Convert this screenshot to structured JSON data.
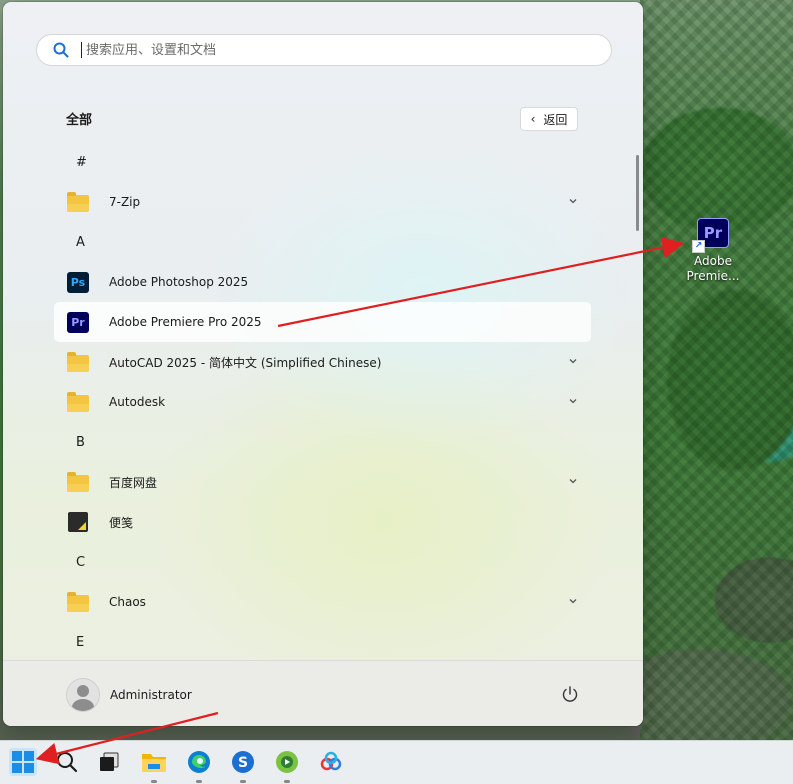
{
  "desktop": {
    "shortcut_icon_label": "Pr",
    "shortcut_caption_line1": "Adobe",
    "shortcut_caption_line2": "Premie..."
  },
  "start_menu": {
    "search_placeholder": "搜索应用、设置和文档",
    "section_title": "全部",
    "back_button": "返回",
    "list": [
      {
        "type": "letter",
        "text": "#"
      },
      {
        "type": "app",
        "icon": "folder-icon",
        "label": "7-Zip",
        "expandable": true
      },
      {
        "type": "letter",
        "text": "A"
      },
      {
        "type": "app",
        "icon": "photoshop-icon",
        "icon_text": "Ps",
        "label": "Adobe Photoshop 2025",
        "expandable": false
      },
      {
        "type": "app",
        "icon": "premiere-icon",
        "icon_text": "Pr",
        "label": "Adobe Premiere Pro 2025",
        "expandable": false,
        "selected": true
      },
      {
        "type": "app",
        "icon": "folder-icon",
        "label": "AutoCAD 2025 - 简体中文 (Simplified Chinese)",
        "expandable": true
      },
      {
        "type": "app",
        "icon": "folder-icon",
        "label": "Autodesk",
        "expandable": true
      },
      {
        "type": "letter",
        "text": "B"
      },
      {
        "type": "app",
        "icon": "folder-icon",
        "label": "百度网盘",
        "expandable": true
      },
      {
        "type": "app",
        "icon": "sticky-notes-icon",
        "label": "便笺",
        "expandable": false
      },
      {
        "type": "letter",
        "text": "C"
      },
      {
        "type": "app",
        "icon": "folder-icon",
        "label": "Chaos",
        "expandable": true
      },
      {
        "type": "letter",
        "text": "E"
      }
    ],
    "user": {
      "name": "Administrator"
    }
  },
  "taskbar": {
    "items": [
      "start-icon",
      "search-icon",
      "task-view-icon",
      "file-explorer-icon",
      "edge-icon",
      "sogou-icon",
      "app-green-icon",
      "baidu-netdisk-icon"
    ]
  },
  "colors": {
    "accent": "#1a8ee6",
    "annotation_arrow": "#e02020"
  }
}
